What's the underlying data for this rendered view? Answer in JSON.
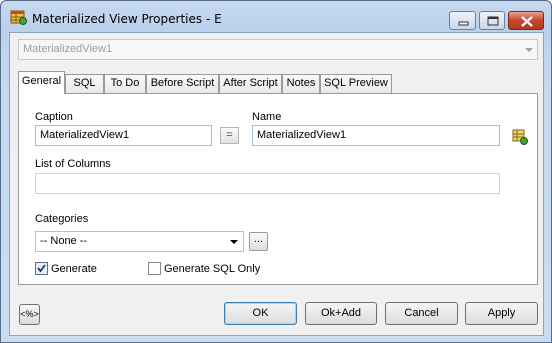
{
  "window": {
    "title": "Materialized View Properties - E",
    "icon": "table-app-icon"
  },
  "object_selector": {
    "value": "MaterializedView1"
  },
  "tabs": [
    {
      "label": "General",
      "active": true
    },
    {
      "label": "SQL",
      "active": false
    },
    {
      "label": "To Do",
      "active": false
    },
    {
      "label": "Before Script",
      "active": false
    },
    {
      "label": "After Script",
      "active": false
    },
    {
      "label": "Notes",
      "active": false
    },
    {
      "label": "SQL Preview",
      "active": false
    }
  ],
  "general": {
    "caption_label": "Caption",
    "caption_value": "MaterializedView1",
    "equals_label": "=",
    "name_label": "Name",
    "name_value": "MaterializedView1",
    "columns_label": "List of Columns",
    "columns_value": "",
    "categories_label": "Categories",
    "categories_value": "-- None --",
    "ellipsis_label": "...",
    "generate_label": "Generate",
    "generate_checked": true,
    "generate_sql_only_label": "Generate SQL Only",
    "generate_sql_only_checked": false
  },
  "buttons": {
    "ok": "OK",
    "ok_add": "Ok+Add",
    "cancel": "Cancel",
    "apply": "Apply",
    "toggle": "<%>"
  }
}
